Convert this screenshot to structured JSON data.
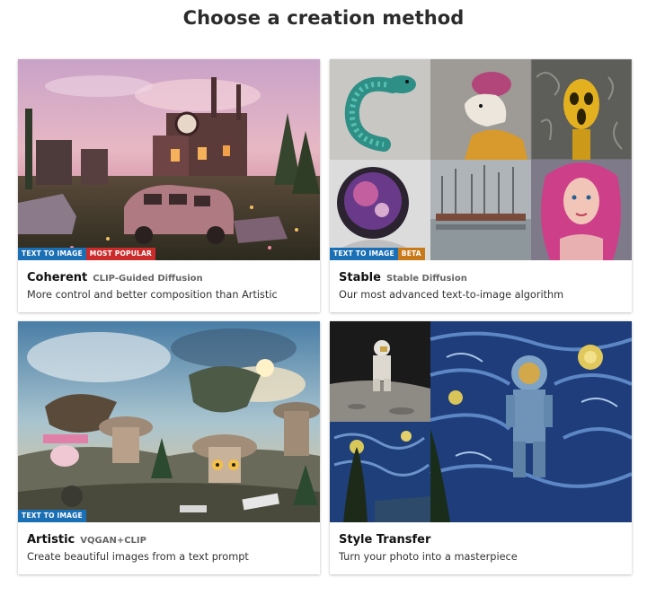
{
  "page": {
    "title": "Choose a creation method"
  },
  "colors": {
    "text_to_image_badge": "#1b6fb5",
    "most_popular_badge": "#cc2b2b",
    "beta_badge": "#c87a1a"
  },
  "cards": [
    {
      "title": "Coherent",
      "subtitle": "CLIP-Guided Diffusion",
      "description": "More control and better composition than Artistic",
      "badges": [
        "TEXT TO IMAGE",
        "MOST POPULAR"
      ]
    },
    {
      "title": "Stable",
      "subtitle": "Stable Diffusion",
      "description": "Our most advanced text-to-image algorithm",
      "badges": [
        "TEXT TO IMAGE",
        "BETA"
      ]
    },
    {
      "title": "Artistic",
      "subtitle": "VQGAN+CLIP",
      "description": "Create beautiful images from a text prompt",
      "badges": [
        "TEXT TO IMAGE"
      ]
    },
    {
      "title": "Style Transfer",
      "subtitle": "",
      "description": "Turn your photo into a masterpiece",
      "badges": []
    }
  ]
}
